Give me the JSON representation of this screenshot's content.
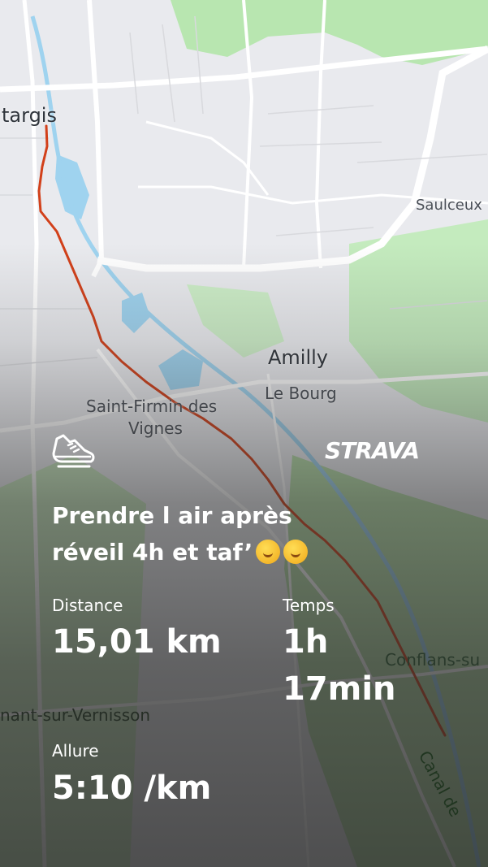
{
  "map": {
    "labels": {
      "montargis": "targis",
      "saulceux": "Saulceux",
      "amilly": "Amilly",
      "le_bourg": "Le Bourg",
      "saint_firmin_1": "Saint-Firmin des",
      "saint_firmin_2": "Vignes",
      "conflans": "Conflans-su",
      "vernisson": "nant-sur-Vernisson",
      "canal": "Canal de"
    },
    "colors": {
      "route": "#d2401a",
      "park": "#b8e6b0",
      "water": "#9fd3ef",
      "road": "#ffffff"
    }
  },
  "brand": "STRAVA",
  "activity": {
    "sport_icon": "running-shoe-icon",
    "title_line1": "Prendre l air après",
    "title_line2": "réveil 4h et taf’",
    "emoji_icon": "yawning-face-icon"
  },
  "stats": {
    "distance_label": "Distance",
    "distance_value": "15,01 km",
    "time_label": "Temps",
    "time_value_line1": "1h",
    "time_value_line2": "17min",
    "pace_label": "Allure",
    "pace_value": "5:10 /km"
  }
}
